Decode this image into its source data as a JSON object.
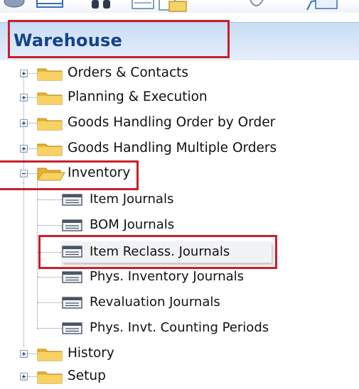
{
  "header": {
    "title": "Warehouse"
  },
  "toolbar": {
    "icons": [
      "toolbar-tool-icon",
      "toolbar-window-icon",
      "toolbar-binoculars-icon",
      "toolbar-list-icon",
      "toolbar-copy-icon",
      "toolbar-bookmark-icon",
      "toolbar-note-icon"
    ]
  },
  "tree": {
    "groups": [
      {
        "label": "Orders & Contacts",
        "state": "collapsed"
      },
      {
        "label": "Planning & Execution",
        "state": "collapsed"
      },
      {
        "label": "Goods Handling Order by Order",
        "state": "collapsed"
      },
      {
        "label": "Goods Handling Multiple Orders",
        "state": "collapsed"
      },
      {
        "label": "Inventory",
        "state": "expanded"
      }
    ],
    "inventory_items": [
      {
        "label": "Item Journals"
      },
      {
        "label": "BOM Journals"
      },
      {
        "label": "Item Reclass. Journals"
      },
      {
        "label": "Phys. Inventory Journals"
      },
      {
        "label": "Revaluation Journals"
      },
      {
        "label": "Phys. Invt. Counting Periods"
      }
    ],
    "bottom_groups": [
      {
        "label": "History",
        "state": "collapsed"
      },
      {
        "label": "Setup",
        "state": "collapsed"
      }
    ]
  },
  "colors": {
    "header_text": "#15428b",
    "highlight_border": "#c8202a",
    "folder": "#f2c23a"
  }
}
